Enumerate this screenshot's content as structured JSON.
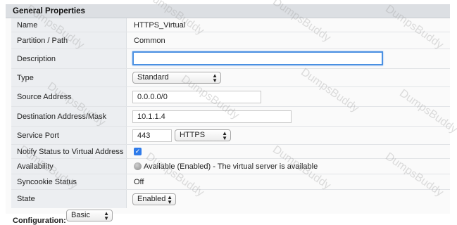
{
  "section": {
    "title": "General Properties"
  },
  "rows": {
    "name": {
      "label": "Name",
      "value": "HTTPS_Virtual"
    },
    "partition": {
      "label": "Partition / Path",
      "value": "Common"
    },
    "description": {
      "label": "Description",
      "value": ""
    },
    "type": {
      "label": "Type",
      "value": "Standard"
    },
    "source": {
      "label": "Source Address",
      "value": "0.0.0.0/0"
    },
    "destination": {
      "label": "Destination Address/Mask",
      "value": "10.1.1.4"
    },
    "service_port": {
      "label": "Service Port",
      "port": "443",
      "protocol": "HTTPS"
    },
    "notify": {
      "label": "Notify Status to Virtual Address",
      "checked": true
    },
    "availability": {
      "label": "Availability",
      "value": "Available (Enabled) - The virtual server is available"
    },
    "syncookie": {
      "label": "Syncookie Status",
      "value": "Off"
    },
    "state": {
      "label": "State",
      "value": "Enabled"
    }
  },
  "configuration": {
    "label": "Configuration:",
    "value": "Basic"
  },
  "icons": {
    "select_arrows": "updown-arrows-icon",
    "check": "checkmark-icon",
    "status": "gray-status-dot-icon"
  },
  "watermark": "DumpsBuddy",
  "colors": {
    "header_bg": "#dcdfe3",
    "label_bg": "#eceef1",
    "focus_border": "#4a90e2",
    "checkbox": "#2f7bea"
  }
}
